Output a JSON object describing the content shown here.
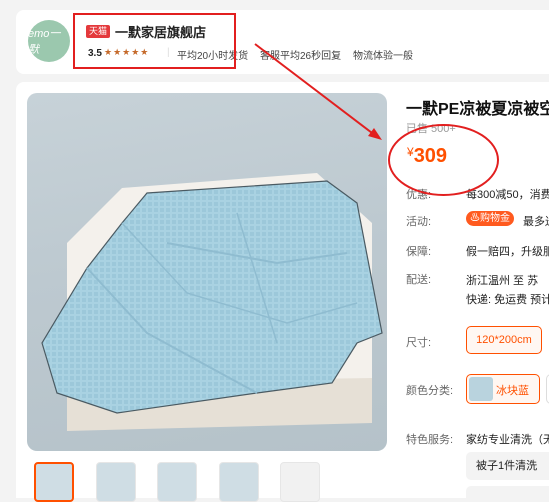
{
  "store": {
    "logo_text": "emo一默",
    "tmall_badge": "天猫",
    "name": "一默家居旗舰店",
    "rating": "3.5",
    "stars": "★★★★★",
    "stat_ship": "平均20小时发货",
    "stat_reply": "客服平均26秒回复",
    "stat_logistics": "物流体验一般"
  },
  "product": {
    "title": "一默PE凉被夏凉被空",
    "sold": "已售 500+",
    "price_currency": "¥",
    "price_value": "309",
    "rows": {
      "promo_label": "优惠:",
      "promo_value": "每300减50，消费",
      "activity_label": "活动:",
      "activity_badge": "♨购物金",
      "activity_value": "最多送",
      "guarantee_label": "保障:",
      "guarantee_value": "假一赔四，升级服",
      "delivery_label": "配送:",
      "delivery_route": "浙江温州  至  苏",
      "delivery_fee": "快递: 免运费  预计",
      "size_label": "尺寸:",
      "size_option": "120*200cm",
      "color_label": "颜色分类:",
      "color_option": "冰块蓝",
      "service_label": "特色服务:",
      "service_value": "家纺专业清洗（无",
      "service_option": "被子1件清洗"
    }
  },
  "thumbnails": [
    "thumb-1",
    "thumb-2",
    "thumb-3",
    "thumb-4",
    "thumb-5"
  ],
  "colors": {
    "accent": "#ff5000",
    "annotation_red": "#e21f1f",
    "tmall_red": "#e4393c"
  }
}
